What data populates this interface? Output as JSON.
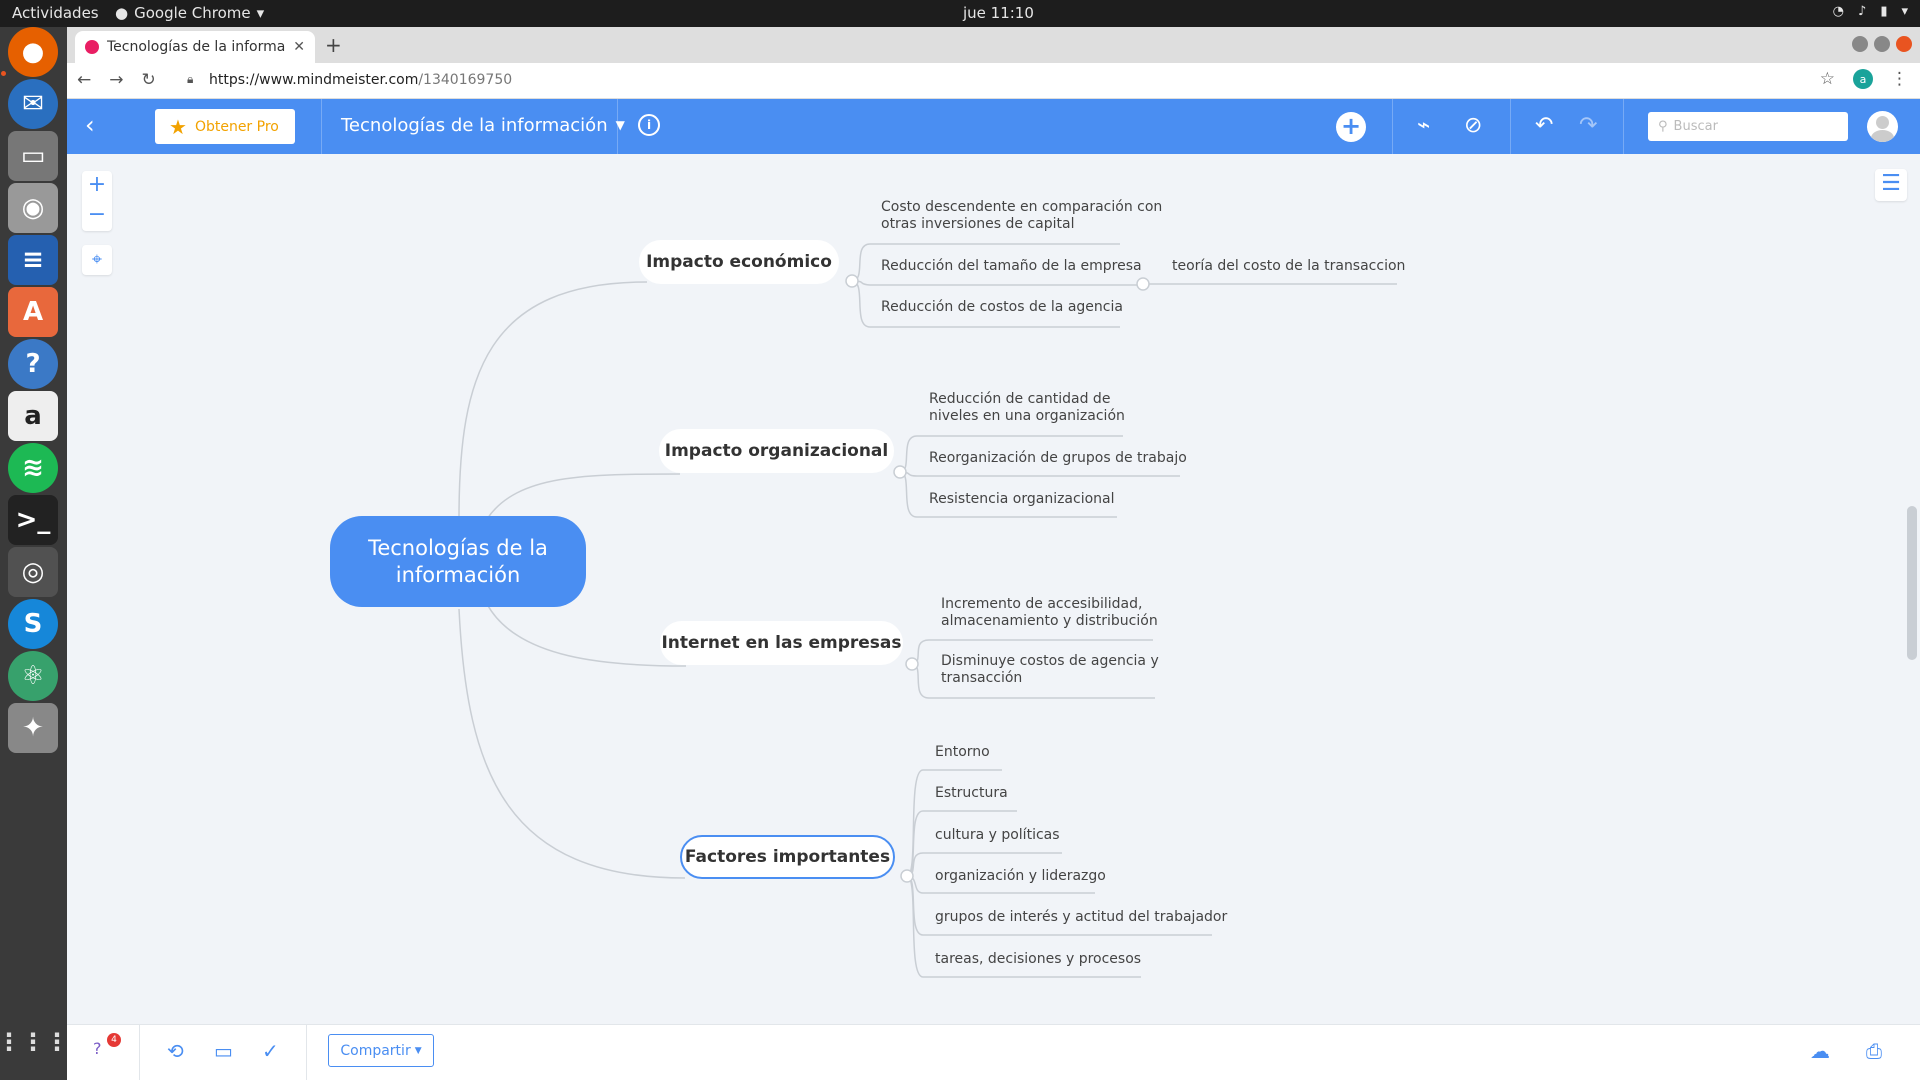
{
  "os_bar": {
    "activities": "Actividades",
    "app_name": "Google Chrome",
    "clock": "jue 11:10"
  },
  "browser": {
    "tab_title": "Tecnologías de la informa",
    "url_host": "https://www.mindmeister.com",
    "url_path": "/1340169750",
    "account_initial": "a"
  },
  "toolbar": {
    "pro_label": "Obtener Pro",
    "map_title": "Tecnologías de la información",
    "search_placeholder": "Buscar"
  },
  "mindmap": {
    "root": "Tecnologías de la información",
    "branches": [
      {
        "label": "Impacto económico",
        "children": [
          {
            "label": "Costo descendente en comparación con\notras inversiones de capital"
          },
          {
            "label": "Reducción del tamaño de la empresa",
            "children": [
              {
                "label": "teoría del costo de la transaccion"
              }
            ]
          },
          {
            "label": "Reducción de costos de la agencia"
          }
        ]
      },
      {
        "label": "Impacto organizacional",
        "children": [
          {
            "label": "Reducción de cantidad de\nniveles en una organización"
          },
          {
            "label": "Reorganización de grupos de trabajo"
          },
          {
            "label": "Resistencia organizacional"
          }
        ]
      },
      {
        "label": "Internet en las empresas",
        "children": [
          {
            "label": "Incremento de accesibilidad,\nalmacenamiento y distribución"
          },
          {
            "label": "Disminuye costos de agencia y\ntransacción"
          }
        ]
      },
      {
        "label": "Factores importantes",
        "selected": true,
        "children": [
          {
            "label": "Entorno"
          },
          {
            "label": "Estructura"
          },
          {
            "label": "cultura y políticas"
          },
          {
            "label": "organización y liderazgo"
          },
          {
            "label": "grupos de interés y actitud del trabajador"
          },
          {
            "label": "tareas, decisiones y procesos"
          }
        ]
      }
    ]
  },
  "bottom": {
    "notification_count": "4",
    "share_label": "Compartir"
  },
  "colors": {
    "brand_blue": "#4a8ef2",
    "canvas": "#f1f4f8",
    "connector": "#c9ced4"
  }
}
